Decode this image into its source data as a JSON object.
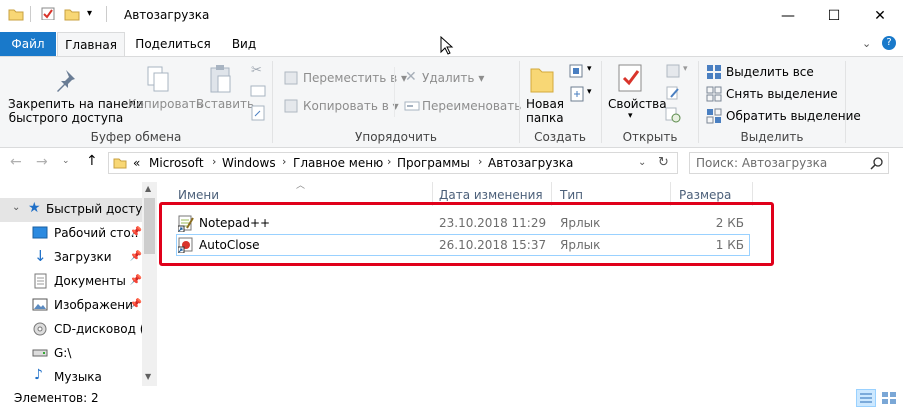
{
  "window": {
    "title": "Автозагрузка",
    "minimize": "—",
    "maximize": "☐",
    "close": "✕"
  },
  "tabs": {
    "file": "Файл",
    "home": "Главная",
    "share": "Поделиться",
    "view": "Вид"
  },
  "ribbon": {
    "clipboard": {
      "pin": "Закрепить на панели\nбыстрого доступа",
      "copy": "Копировать",
      "paste": "Вставить",
      "label": "Буфер обмена"
    },
    "organize": {
      "move_to": "Переместить в",
      "copy_to": "Копировать в",
      "delete": "Удалить",
      "rename": "Переименовать",
      "label": "Упорядочить"
    },
    "new": {
      "new_folder": "Новая\nпапка",
      "label": "Создать"
    },
    "open": {
      "properties": "Свойства",
      "label": "Открыть"
    },
    "select": {
      "select_all": "Выделить все",
      "select_none": "Снять выделение",
      "invert": "Обратить выделение",
      "label": "Выделить"
    }
  },
  "address": {
    "prefix": "«",
    "crumbs": [
      "Microsoft",
      "Windows",
      "Главное меню",
      "Программы",
      "Автозагрузка"
    ],
    "search_placeholder": "Поиск: Автозагрузка"
  },
  "nav": [
    {
      "label": "Быстрый доступ",
      "pinned": false
    },
    {
      "label": "Рабочий сто...",
      "pinned": true
    },
    {
      "label": "Загрузки",
      "pinned": true
    },
    {
      "label": "Документы",
      "pinned": true
    },
    {
      "label": "Изображени",
      "pinned": true
    },
    {
      "label": "CD-дисковод (F",
      "pinned": false
    },
    {
      "label": "G:\\",
      "pinned": false
    },
    {
      "label": "Музыка",
      "pinned": false
    }
  ],
  "columns": {
    "name": "Имени",
    "date": "Дата изменения",
    "type": "Тип",
    "size": "Размера"
  },
  "files": [
    {
      "name": "Notepad++",
      "date": "23.10.2018 11:29",
      "type": "Ярлык",
      "size": "2 КБ"
    },
    {
      "name": "AutoClose",
      "date": "26.10.2018 15:37",
      "type": "Ярлык",
      "size": "1 КБ"
    }
  ],
  "status": {
    "count": "Элементов: 2"
  },
  "colors": {
    "accent": "#1979ca",
    "highlight": "#e0001a",
    "folder": "#f8d775"
  }
}
